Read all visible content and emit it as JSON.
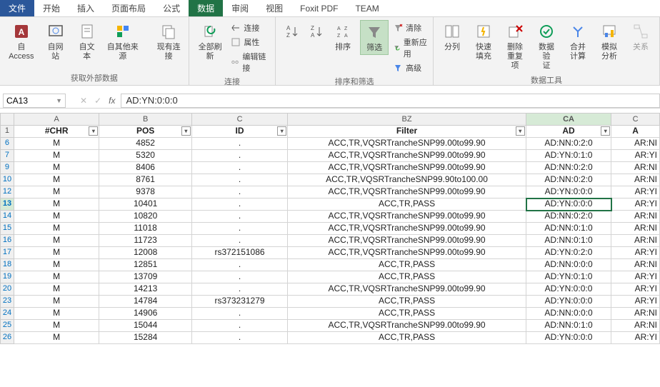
{
  "menu": {
    "file": "文件",
    "tabs": [
      "开始",
      "插入",
      "页面布局",
      "公式",
      "数据",
      "审阅",
      "视图",
      "Foxit PDF",
      "TEAM"
    ],
    "active": 4
  },
  "ribbon": {
    "ext": {
      "access": "自 Access",
      "web": "自网站",
      "text": "自文本",
      "other": "自其他来源",
      "existing": "现有连接",
      "group": "获取外部数据"
    },
    "conn": {
      "refresh": "全部刷新",
      "c1": "连接",
      "c2": "属性",
      "c3": "编辑链接",
      "group": "连接"
    },
    "sort": {
      "sort": "排序",
      "filter": "筛选",
      "clear": "清除",
      "reapply": "重新应用",
      "adv": "高级",
      "group": "排序和筛选"
    },
    "tools": {
      "split": "分列",
      "flash": "快速填充",
      "dedup": "删除\n重复项",
      "valid": "数据验\n证",
      "consol": "合并计算",
      "whatif": "模拟分析",
      "rel": "关系",
      "group": "数据工具"
    }
  },
  "fbar": {
    "name": "CA13",
    "formula": "AD:YN:0:0:0"
  },
  "cols": [
    {
      "letter": "A",
      "cls": "w-chr"
    },
    {
      "letter": "B",
      "cls": "w-pos"
    },
    {
      "letter": "C",
      "cls": "w-id"
    },
    {
      "letter": "BZ",
      "cls": "w-bz"
    },
    {
      "letter": "CA",
      "cls": "w-ca",
      "active": true
    },
    {
      "letter": "C",
      "cls": "w-cb"
    }
  ],
  "headers": {
    "chr": "#CHR",
    "pos": "POS",
    "id": "ID",
    "filter": "Filter",
    "ad": "AD",
    "ar": "A"
  },
  "rows": [
    {
      "n": 6,
      "chr": "M",
      "pos": "4852",
      "id": ".",
      "filter": "ACC,TR,VQSRTrancheSNP99.00to99.90",
      "ad": "AD:NN:0:2:0",
      "ar": "AR:NI"
    },
    {
      "n": 7,
      "chr": "M",
      "pos": "5320",
      "id": ".",
      "filter": "ACC,TR,VQSRTrancheSNP99.00to99.90",
      "ad": "AD:YN:0:1:0",
      "ar": "AR:YI"
    },
    {
      "n": 9,
      "chr": "M",
      "pos": "8406",
      "id": ".",
      "filter": "ACC,TR,VQSRTrancheSNP99.00to99.90",
      "ad": "AD:NN:0:2:0",
      "ar": "AR:NI"
    },
    {
      "n": 10,
      "chr": "M",
      "pos": "8761",
      "id": ".",
      "filter": "ACC,TR,VQSRTrancheSNP99.90to100.00",
      "ad": "AD:NN:0:2:0",
      "ar": "AR:NI"
    },
    {
      "n": 12,
      "chr": "M",
      "pos": "9378",
      "id": ".",
      "filter": "ACC,TR,VQSRTrancheSNP99.00to99.90",
      "ad": "AD:YN:0:0:0",
      "ar": "AR:YI"
    },
    {
      "n": 13,
      "chr": "M",
      "pos": "10401",
      "id": ".",
      "filter": "ACC,TR,PASS",
      "ad": "AD:YN:0:0:0",
      "ar": "AR:YI",
      "active": true
    },
    {
      "n": 14,
      "chr": "M",
      "pos": "10820",
      "id": ".",
      "filter": "ACC,TR,VQSRTrancheSNP99.00to99.90",
      "ad": "AD:NN:0:2:0",
      "ar": "AR:NI"
    },
    {
      "n": 15,
      "chr": "M",
      "pos": "11018",
      "id": ".",
      "filter": "ACC,TR,VQSRTrancheSNP99.00to99.90",
      "ad": "AD:NN:0:1:0",
      "ar": "AR:NI"
    },
    {
      "n": 16,
      "chr": "M",
      "pos": "11723",
      "id": ".",
      "filter": "ACC,TR,VQSRTrancheSNP99.00to99.90",
      "ad": "AD:NN:0:1:0",
      "ar": "AR:NI"
    },
    {
      "n": 17,
      "chr": "M",
      "pos": "12008",
      "id": "rs372151086",
      "filter": "ACC,TR,VQSRTrancheSNP99.00to99.90",
      "ad": "AD:YN:0:2:0",
      "ar": "AR:YI"
    },
    {
      "n": 18,
      "chr": "M",
      "pos": "12851",
      "id": ".",
      "filter": "ACC,TR,PASS",
      "ad": "AD:NN:0:0:0",
      "ar": "AR:NI"
    },
    {
      "n": 19,
      "chr": "M",
      "pos": "13709",
      "id": ".",
      "filter": "ACC,TR,PASS",
      "ad": "AD:YN:0:1:0",
      "ar": "AR:YI"
    },
    {
      "n": 20,
      "chr": "M",
      "pos": "14213",
      "id": ".",
      "filter": "ACC,TR,VQSRTrancheSNP99.00to99.90",
      "ad": "AD:YN:0:0:0",
      "ar": "AR:YI"
    },
    {
      "n": 23,
      "chr": "M",
      "pos": "14784",
      "id": "rs373231279",
      "filter": "ACC,TR,PASS",
      "ad": "AD:YN:0:0:0",
      "ar": "AR:YI"
    },
    {
      "n": 24,
      "chr": "M",
      "pos": "14906",
      "id": ".",
      "filter": "ACC,TR,PASS",
      "ad": "AD:NN:0:0:0",
      "ar": "AR:NI"
    },
    {
      "n": 25,
      "chr": "M",
      "pos": "15044",
      "id": ".",
      "filter": "ACC,TR,VQSRTrancheSNP99.00to99.90",
      "ad": "AD:NN:0:1:0",
      "ar": "AR:NI"
    },
    {
      "n": 26,
      "chr": "M",
      "pos": "15284",
      "id": ".",
      "filter": "ACC,TR,PASS",
      "ad": "AD:YN:0:0:0",
      "ar": "AR:YI"
    }
  ]
}
